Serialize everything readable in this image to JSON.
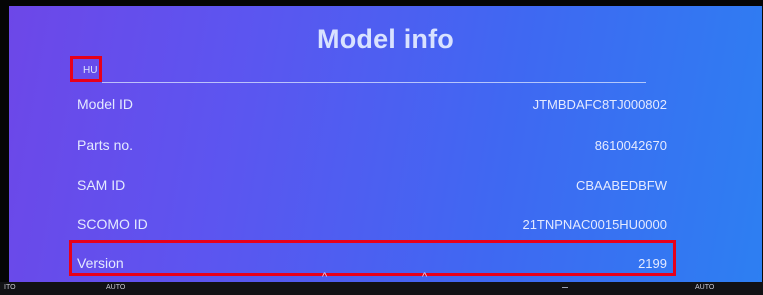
{
  "header": {
    "title": "Model info"
  },
  "section": {
    "tab_label": "HU"
  },
  "rows": [
    {
      "label": "Model ID",
      "value": "JTMBDAFC8TJ000802"
    },
    {
      "label": "Parts no.",
      "value": "8610042670"
    },
    {
      "label": "SAM ID",
      "value": "CBAABEDBFW"
    },
    {
      "label": "SCOMO ID",
      "value": "21TNPNAC0015HU0000"
    },
    {
      "label": "Version",
      "value": "2199"
    }
  ],
  "bottom_bar": {
    "left": "ITO",
    "auto_left": "AUTO",
    "auto_right": "AUTO",
    "chevron": "^"
  },
  "colors": {
    "highlight_red": "#e8001a",
    "gradient_start": "#6d47e8",
    "gradient_end": "#2d7ff2"
  }
}
